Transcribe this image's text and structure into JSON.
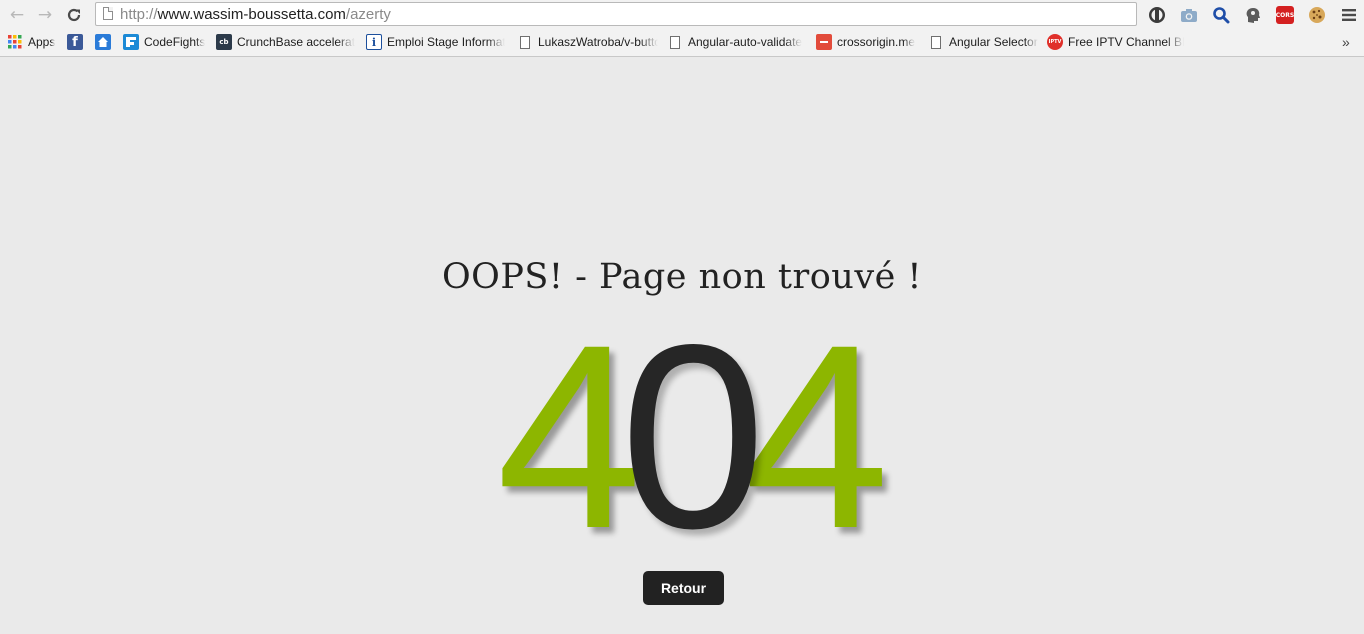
{
  "browser": {
    "url_prefix": "http://",
    "url_host": "www.wassim-boussetta.com",
    "url_path": "/azerty",
    "extensions": [
      {
        "icon": "privacy-shield-icon"
      },
      {
        "icon": "camera-icon"
      },
      {
        "icon": "search-icon"
      },
      {
        "icon": "head-icon"
      },
      {
        "icon": "cors-icon",
        "label": "CORS"
      },
      {
        "icon": "cookie-icon"
      }
    ],
    "bookmarks": [
      {
        "label": "Apps",
        "icon": "apps-grid-icon"
      },
      {
        "label": "",
        "icon": "facebook-icon"
      },
      {
        "label": "",
        "icon": "home-icon"
      },
      {
        "label": "CodeFights",
        "icon": "codefights-icon"
      },
      {
        "label": "CrunchBase accelerator",
        "icon": "crunchbase-icon"
      },
      {
        "label": "Emploi Stage Informatique",
        "icon": "info-icon"
      },
      {
        "label": "LukaszWatroba/v-button",
        "icon": "document-icon"
      },
      {
        "label": "Angular-auto-validate",
        "icon": "document-icon"
      },
      {
        "label": "crossorigin.me",
        "icon": "crossorigin-icon"
      },
      {
        "label": "Angular Selector",
        "icon": "document-icon"
      },
      {
        "label": "Free IPTV Channel BBC",
        "icon": "iptv-icon",
        "icon_text": "IPTV"
      }
    ],
    "overflow_label": "»"
  },
  "page": {
    "headline": "OOPS! - Page non trouvé !",
    "code_first": "4",
    "code_middle": "0",
    "code_last": "4",
    "back_button_label": "Retour"
  },
  "colors": {
    "accent_green": "#8db600",
    "dark": "#262626",
    "background": "#eaeaea"
  }
}
